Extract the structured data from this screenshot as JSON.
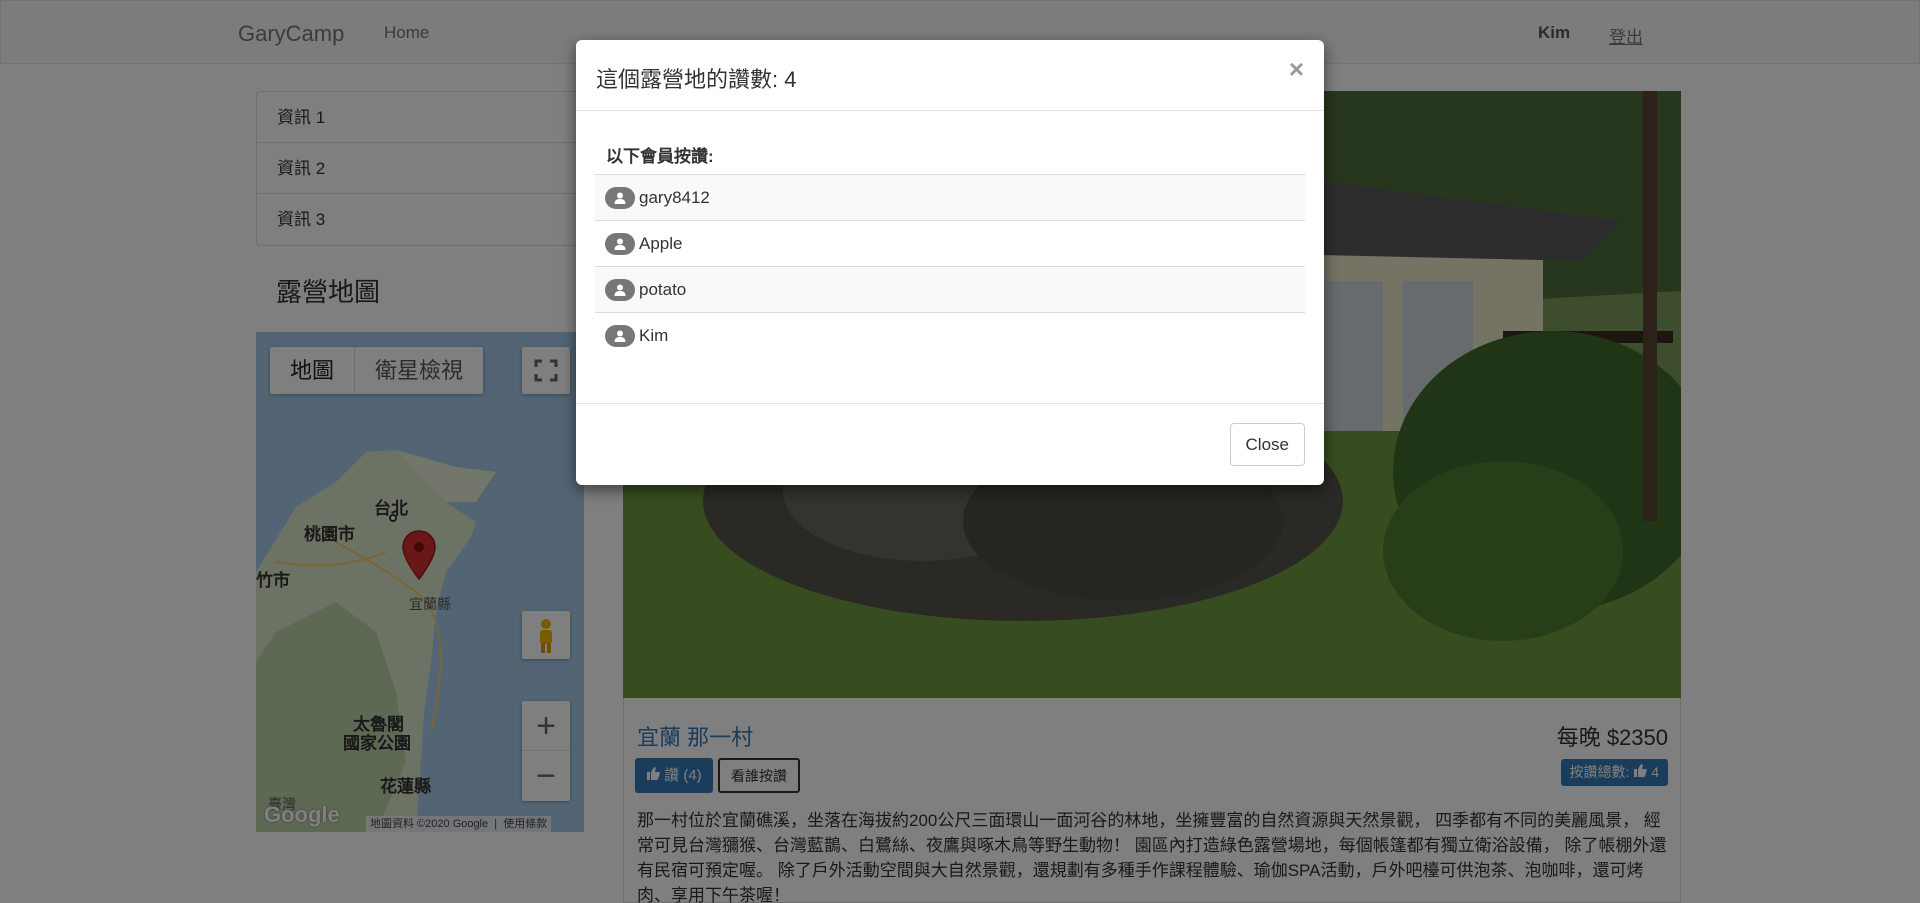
{
  "navbar": {
    "brand": "GaryCamp",
    "home": "Home",
    "user": "Kim",
    "logout": "登出"
  },
  "sidebar": {
    "items": [
      {
        "label": "資訊 1"
      },
      {
        "label": "資訊 2"
      },
      {
        "label": "資訊 3"
      }
    ],
    "map_title": "露營地圖"
  },
  "map": {
    "type_map": "地圖",
    "type_satellite": "衛星檢視",
    "zoom_in": "+",
    "zoom_out": "−",
    "labels": {
      "taipei": "台北",
      "taoyuan": "桃園市",
      "hsinchu": "竹市",
      "yilan": "宜蘭縣",
      "park_line1": "太魯閣",
      "park_line2": "國家公園",
      "hualien": "花蓮縣",
      "taiwan": "臺灣"
    },
    "logo": "Google",
    "attribution": "地圖資料 ©2020 Google",
    "terms": "使用條款"
  },
  "camp": {
    "name": "宜蘭 那一村",
    "price": "每晚 $2350",
    "like_button": "讚 (4)",
    "who_liked_button": "看誰按讚",
    "total_likes_label": "按讚總數:",
    "total_likes_count": "4",
    "description": "那一村位於宜蘭礁溪，坐落在海拔約200公尺三面環山一面河谷的林地，坐擁豐富的自然資源與天然景觀， 四季都有不同的美麗風景， 經常可見台灣獼猴、台灣藍鵲、白鷺絲、夜鷹與啄木鳥等野生動物！ 園區內打造綠色露營場地，每個帳篷都有獨立衛浴設備， 除了帳棚外還有民宿可預定喔。 除了戶外活動空間與大自然景觀，還規劃有多種手作課程體驗、瑜伽SPA活動，戶外吧檯可供泡茶、泡咖啡，還可烤肉、享用下午茶喔！"
  },
  "modal": {
    "title": "這個露營地的讚數: 4",
    "close_x": "×",
    "heading": "以下會員按讚:",
    "likers": [
      {
        "name": "gary8412"
      },
      {
        "name": "Apple"
      },
      {
        "name": "potato"
      },
      {
        "name": "Kim"
      }
    ],
    "close_button": "Close"
  },
  "colors": {
    "primary": "#337ab7",
    "backdrop": "rgba(0,0,0,0.5)",
    "map_water": "#a6cbe8",
    "map_pin": "#d32f2f"
  }
}
